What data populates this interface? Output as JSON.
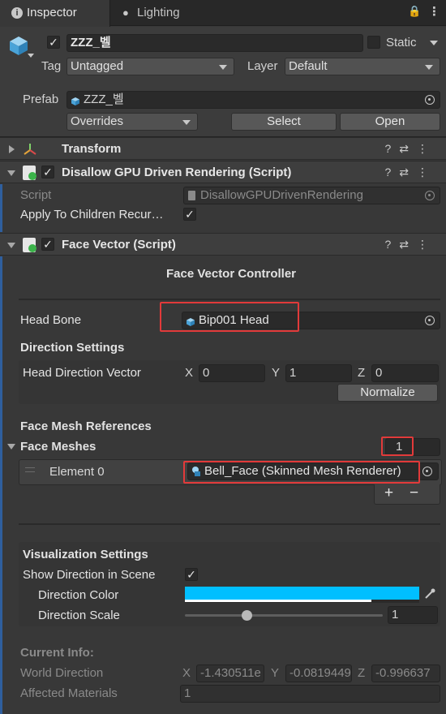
{
  "tabs": {
    "inspector": "Inspector",
    "lighting": "Lighting"
  },
  "object": {
    "name": "ZZZ_벨",
    "static_label": "Static",
    "tag_label": "Tag",
    "tag_value": "Untagged",
    "layer_label": "Layer",
    "layer_value": "Default",
    "prefab_label": "Prefab",
    "prefab_value": "ZZZ_벨",
    "overrides": "Overrides",
    "select": "Select",
    "open": "Open"
  },
  "components": {
    "transform": "Transform",
    "disallow": {
      "title": "Disallow GPU Driven Rendering (Script)",
      "script_label": "Script",
      "script_value": "DisallowGPUDrivenRendering",
      "apply_label": "Apply To Children Recur…"
    },
    "face_vector": {
      "title": "Face Vector (Script)",
      "controller_title": "Face Vector Controller",
      "head_bone_label": "Head Bone",
      "head_bone_value": "Bip001 Head",
      "direction_settings": "Direction Settings",
      "head_direction_label": "Head Direction Vector",
      "x_label": "X",
      "x_value": "0",
      "y_label": "Y",
      "y_value": "1",
      "z_label": "Z",
      "z_value": "0",
      "normalize": "Normalize",
      "mesh_refs": "Face Mesh References",
      "face_meshes": "Face Meshes",
      "face_meshes_count": "1",
      "element0_label": "Element 0",
      "element0_value": "Bell_Face (Skinned Mesh Renderer)",
      "plus": "+",
      "minus": "−",
      "vis_settings": "Visualization Settings",
      "show_dir_label": "Show Direction in Scene",
      "dir_color_label": "Direction Color",
      "dir_color": "#00bfff",
      "dir_scale_label": "Direction Scale",
      "dir_scale_value": "1",
      "current_info": "Current Info:",
      "world_dir_label": "World Direction",
      "wx_label": "X",
      "wx_value": "-1.430511e",
      "wy_label": "Y",
      "wy_value": "-0.0819449",
      "wz_label": "Z",
      "wz_value": "-0.996637",
      "affected_label": "Affected Materials",
      "affected_value": "1"
    }
  },
  "colors": {
    "accent_highlight": "#e23a3a",
    "panel_bg": "#383838"
  }
}
